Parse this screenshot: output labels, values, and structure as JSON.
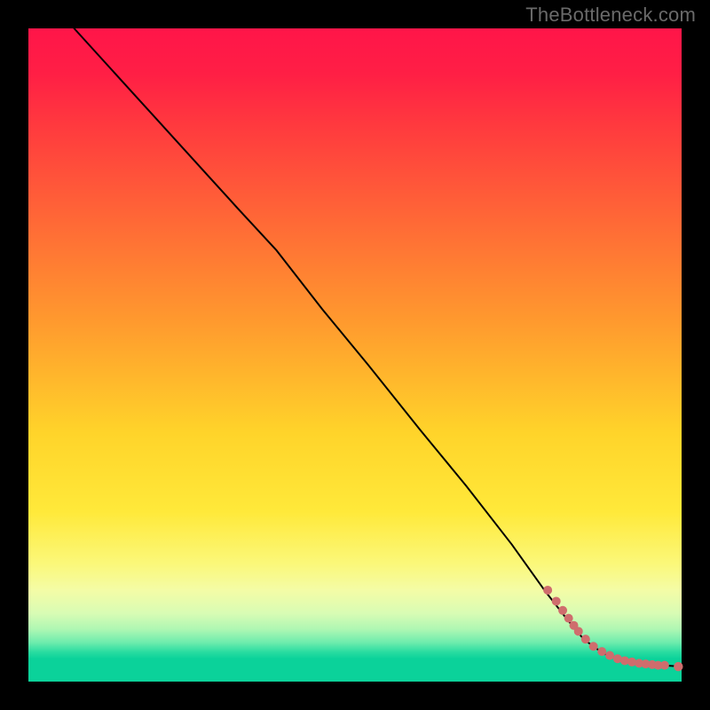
{
  "watermark_text": "TheBottleneck.com",
  "colors": {
    "frame_bg": "#000000",
    "watermark": "#6a6a6a",
    "curve": "#000000",
    "dot": "#cf6d6d"
  },
  "chart_data": {
    "type": "line",
    "title": "",
    "xlabel": "",
    "ylabel": "",
    "xlim": [
      0,
      100
    ],
    "ylim": [
      0,
      100
    ],
    "curve": {
      "x": [
        7,
        27,
        32,
        38,
        45,
        52,
        60,
        67,
        74,
        79,
        82.5,
        85,
        88,
        91,
        94,
        97,
        100
      ],
      "y": [
        100,
        78,
        72.5,
        66,
        57,
        48.5,
        38.5,
        30,
        21,
        14,
        9.5,
        6.5,
        4.3,
        3.2,
        2.7,
        2.5,
        2.3
      ]
    },
    "dots": {
      "x": [
        79.5,
        80.8,
        81.8,
        82.7,
        83.5,
        84.2,
        85.3,
        86.5,
        87.8,
        89.0,
        90.2,
        91.3,
        92.4,
        93.5,
        94.5,
        95.5,
        96.4,
        97.4,
        99.5
      ],
      "y": [
        14.0,
        12.3,
        10.9,
        9.7,
        8.6,
        7.7,
        6.5,
        5.4,
        4.6,
        4.0,
        3.5,
        3.2,
        3.0,
        2.8,
        2.7,
        2.6,
        2.5,
        2.5,
        2.3
      ]
    }
  }
}
